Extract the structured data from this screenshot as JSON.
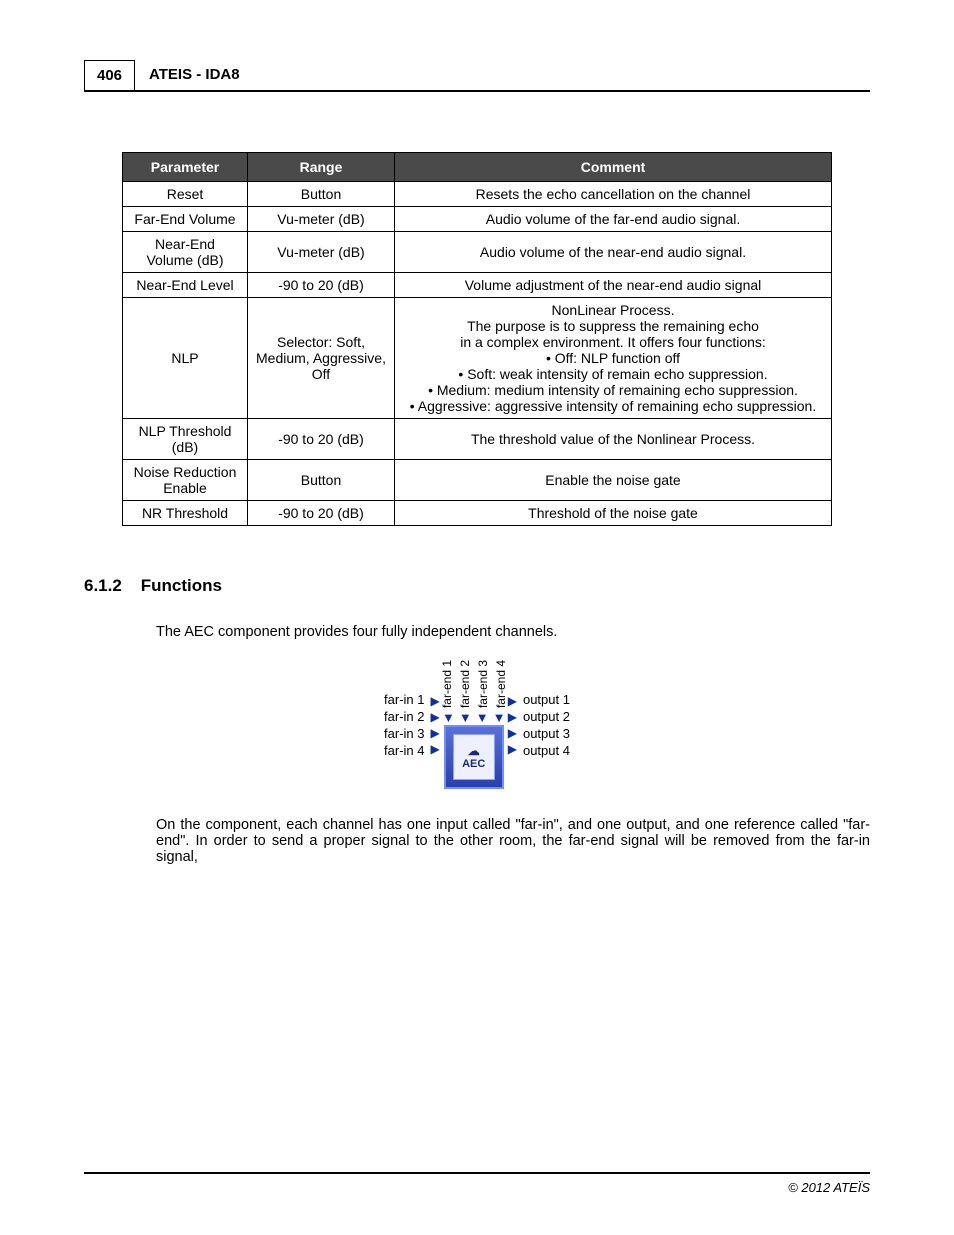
{
  "page_number": "406",
  "doc_title": "ATEIS - IDA8",
  "table": {
    "headers": [
      "Parameter",
      "Range",
      "Comment"
    ],
    "rows": [
      {
        "param": "Reset",
        "range": "Button",
        "comment": "Resets the echo cancellation on the channel"
      },
      {
        "param": "Far-End Volume",
        "range": "Vu-meter (dB)",
        "comment": "Audio volume of the far-end audio signal."
      },
      {
        "param": "Near-End Volume (dB)",
        "range": "Vu-meter (dB)",
        "comment": "Audio volume of the near-end audio signal."
      },
      {
        "param": "Near-End Level",
        "range": "-90 to 20 (dB)",
        "comment": "Volume adjustment of the near-end audio signal"
      },
      {
        "param": "NLP",
        "range": "Selector: Soft, Medium, Aggressive, Off",
        "comment_intro1": "NonLinear Process.",
        "comment_intro2": "The purpose is to suppress the remaining echo",
        "comment_intro3": "in a complex environment. It offers four functions:",
        "bullets": [
          "Off: NLP function off",
          "Soft: weak intensity of remain echo suppression.",
          "Medium: medium intensity of remaining echo suppression.",
          "Aggressive: aggressive intensity of remaining echo suppression."
        ]
      },
      {
        "param": "NLP Threshold (dB)",
        "range": "-90 to 20 (dB)",
        "comment": "The threshold value of the Nonlinear Process."
      },
      {
        "param": "Noise Reduction Enable",
        "range": "Button",
        "comment": "Enable the noise gate"
      },
      {
        "param": "NR Threshold",
        "range": "-90 to 20 (dB)",
        "comment": "Threshold of the noise gate"
      }
    ]
  },
  "section": {
    "number": "6.1.2",
    "title": "Functions"
  },
  "paragraphs": {
    "p1": "The AEC component provides four fully independent channels.",
    "p2": "On the component, each channel has one input called \"far-in\", and one output, and one reference called \"far-end\". In order to send a proper signal to the other room, the far-end signal will be removed from the far-in signal,"
  },
  "diagram": {
    "top": [
      "far-end 1",
      "far-end 2",
      "far-end 3",
      "far-end 4"
    ],
    "left": [
      "far-in 1",
      "far-in 2",
      "far-in 3",
      "far-in 4"
    ],
    "right": [
      "output 1",
      "output 2",
      "output 3",
      "output 4"
    ],
    "center_label": "AEC"
  },
  "copyright": "© 2012 ATEÏS"
}
